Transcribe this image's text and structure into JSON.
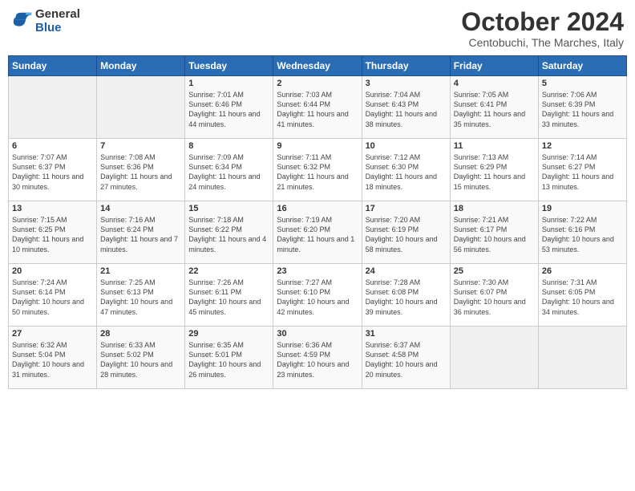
{
  "logo": {
    "general": "General",
    "blue": "Blue"
  },
  "header": {
    "month": "October 2024",
    "location": "Centobuchi, The Marches, Italy"
  },
  "weekdays": [
    "Sunday",
    "Monday",
    "Tuesday",
    "Wednesday",
    "Thursday",
    "Friday",
    "Saturday"
  ],
  "weeks": [
    [
      {
        "day": "",
        "info": ""
      },
      {
        "day": "",
        "info": ""
      },
      {
        "day": "1",
        "info": "Sunrise: 7:01 AM\nSunset: 6:46 PM\nDaylight: 11 hours and 44 minutes."
      },
      {
        "day": "2",
        "info": "Sunrise: 7:03 AM\nSunset: 6:44 PM\nDaylight: 11 hours and 41 minutes."
      },
      {
        "day": "3",
        "info": "Sunrise: 7:04 AM\nSunset: 6:43 PM\nDaylight: 11 hours and 38 minutes."
      },
      {
        "day": "4",
        "info": "Sunrise: 7:05 AM\nSunset: 6:41 PM\nDaylight: 11 hours and 35 minutes."
      },
      {
        "day": "5",
        "info": "Sunrise: 7:06 AM\nSunset: 6:39 PM\nDaylight: 11 hours and 33 minutes."
      }
    ],
    [
      {
        "day": "6",
        "info": "Sunrise: 7:07 AM\nSunset: 6:37 PM\nDaylight: 11 hours and 30 minutes."
      },
      {
        "day": "7",
        "info": "Sunrise: 7:08 AM\nSunset: 6:36 PM\nDaylight: 11 hours and 27 minutes."
      },
      {
        "day": "8",
        "info": "Sunrise: 7:09 AM\nSunset: 6:34 PM\nDaylight: 11 hours and 24 minutes."
      },
      {
        "day": "9",
        "info": "Sunrise: 7:11 AM\nSunset: 6:32 PM\nDaylight: 11 hours and 21 minutes."
      },
      {
        "day": "10",
        "info": "Sunrise: 7:12 AM\nSunset: 6:30 PM\nDaylight: 11 hours and 18 minutes."
      },
      {
        "day": "11",
        "info": "Sunrise: 7:13 AM\nSunset: 6:29 PM\nDaylight: 11 hours and 15 minutes."
      },
      {
        "day": "12",
        "info": "Sunrise: 7:14 AM\nSunset: 6:27 PM\nDaylight: 11 hours and 13 minutes."
      }
    ],
    [
      {
        "day": "13",
        "info": "Sunrise: 7:15 AM\nSunset: 6:25 PM\nDaylight: 11 hours and 10 minutes."
      },
      {
        "day": "14",
        "info": "Sunrise: 7:16 AM\nSunset: 6:24 PM\nDaylight: 11 hours and 7 minutes."
      },
      {
        "day": "15",
        "info": "Sunrise: 7:18 AM\nSunset: 6:22 PM\nDaylight: 11 hours and 4 minutes."
      },
      {
        "day": "16",
        "info": "Sunrise: 7:19 AM\nSunset: 6:20 PM\nDaylight: 11 hours and 1 minute."
      },
      {
        "day": "17",
        "info": "Sunrise: 7:20 AM\nSunset: 6:19 PM\nDaylight: 10 hours and 58 minutes."
      },
      {
        "day": "18",
        "info": "Sunrise: 7:21 AM\nSunset: 6:17 PM\nDaylight: 10 hours and 56 minutes."
      },
      {
        "day": "19",
        "info": "Sunrise: 7:22 AM\nSunset: 6:16 PM\nDaylight: 10 hours and 53 minutes."
      }
    ],
    [
      {
        "day": "20",
        "info": "Sunrise: 7:24 AM\nSunset: 6:14 PM\nDaylight: 10 hours and 50 minutes."
      },
      {
        "day": "21",
        "info": "Sunrise: 7:25 AM\nSunset: 6:13 PM\nDaylight: 10 hours and 47 minutes."
      },
      {
        "day": "22",
        "info": "Sunrise: 7:26 AM\nSunset: 6:11 PM\nDaylight: 10 hours and 45 minutes."
      },
      {
        "day": "23",
        "info": "Sunrise: 7:27 AM\nSunset: 6:10 PM\nDaylight: 10 hours and 42 minutes."
      },
      {
        "day": "24",
        "info": "Sunrise: 7:28 AM\nSunset: 6:08 PM\nDaylight: 10 hours and 39 minutes."
      },
      {
        "day": "25",
        "info": "Sunrise: 7:30 AM\nSunset: 6:07 PM\nDaylight: 10 hours and 36 minutes."
      },
      {
        "day": "26",
        "info": "Sunrise: 7:31 AM\nSunset: 6:05 PM\nDaylight: 10 hours and 34 minutes."
      }
    ],
    [
      {
        "day": "27",
        "info": "Sunrise: 6:32 AM\nSunset: 5:04 PM\nDaylight: 10 hours and 31 minutes."
      },
      {
        "day": "28",
        "info": "Sunrise: 6:33 AM\nSunset: 5:02 PM\nDaylight: 10 hours and 28 minutes."
      },
      {
        "day": "29",
        "info": "Sunrise: 6:35 AM\nSunset: 5:01 PM\nDaylight: 10 hours and 26 minutes."
      },
      {
        "day": "30",
        "info": "Sunrise: 6:36 AM\nSunset: 4:59 PM\nDaylight: 10 hours and 23 minutes."
      },
      {
        "day": "31",
        "info": "Sunrise: 6:37 AM\nSunset: 4:58 PM\nDaylight: 10 hours and 20 minutes."
      },
      {
        "day": "",
        "info": ""
      },
      {
        "day": "",
        "info": ""
      }
    ]
  ]
}
